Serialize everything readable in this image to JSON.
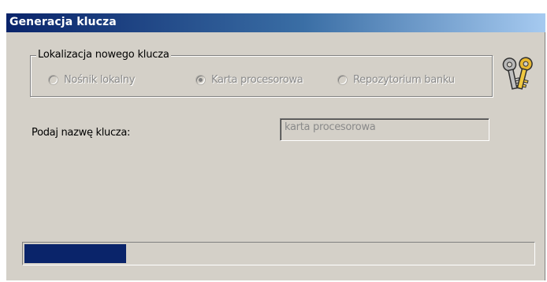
{
  "window": {
    "title": "Generacja klucza"
  },
  "location_group": {
    "legend": "Lokalizacja nowego klucza",
    "options": [
      {
        "label": "Nośnik lokalny",
        "checked": false,
        "enabled": false
      },
      {
        "label": "Karta procesorowa",
        "checked": true,
        "enabled": false
      },
      {
        "label": "Repozytorium banku",
        "checked": false,
        "enabled": false
      }
    ]
  },
  "key_name": {
    "label": "Podaj nazwę klucza:",
    "value": "karta procesorowa",
    "enabled": false
  },
  "progress": {
    "fraction": 0.2
  },
  "icons": {
    "keys": "keys-icon"
  },
  "colors": {
    "titlebar": "#0a246a",
    "progress_fill": "#0a246a",
    "dialog_bg": "#d4d0c8"
  }
}
